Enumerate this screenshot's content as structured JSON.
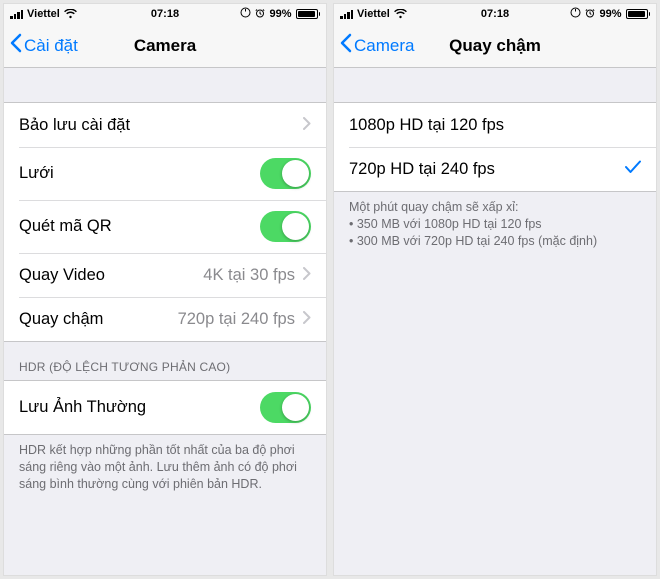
{
  "statusBar": {
    "carrier": "Viettel",
    "time": "07:18",
    "batteryPercent": "99%"
  },
  "left": {
    "backLabel": "Cài đặt",
    "title": "Camera",
    "group1": {
      "preserve": "Bảo lưu cài đặt",
      "grid": "Lưới",
      "qr": "Quét mã QR",
      "recordVideo": "Quay Video",
      "recordVideoValue": "4K tại 30 fps",
      "slomo": "Quay chậm",
      "slomoValue": "720p tại 240 fps"
    },
    "hdrHeader": "HDR (ĐỘ LỆCH TƯƠNG PHẢN CAO)",
    "hdr": {
      "keepNormal": "Lưu Ảnh Thường"
    },
    "hdrFooter": "HDR kết hợp những phần tốt nhất của ba độ phơi sáng riêng vào một ảnh. Lưu thêm ảnh có độ phơi sáng bình thường cùng với phiên bản HDR."
  },
  "right": {
    "backLabel": "Camera",
    "title": "Quay chậm",
    "options": {
      "opt1": "1080p HD tại 120 fps",
      "opt2": "720p HD tại 240 fps"
    },
    "footerIntro": "Một phút quay chậm sẽ xấp xỉ:",
    "footerLine1": "350 MB với 1080p HD tại 120 fps",
    "footerLine2": "300 MB với 720p HD tại 240 fps (mặc định)"
  }
}
